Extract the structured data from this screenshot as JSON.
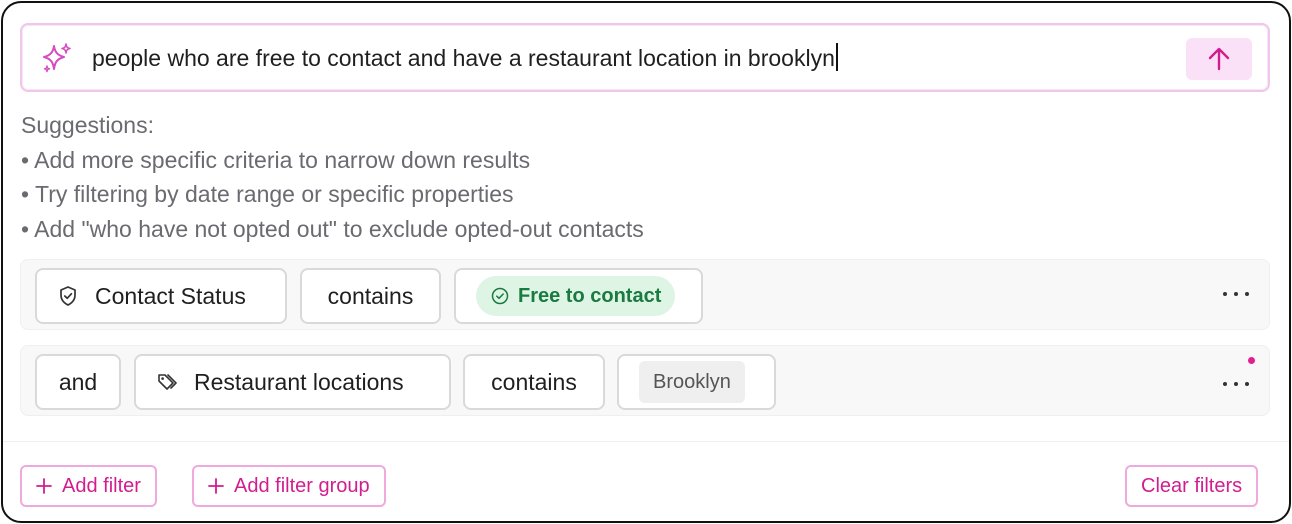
{
  "prompt": {
    "query": "people who are free to contact and have a restaurant location in brooklyn",
    "sparkle_icon": "sparkles-icon",
    "send_icon": "arrow-up-icon"
  },
  "suggestions": {
    "title": "Suggestions:",
    "items": [
      "• Add more specific criteria to narrow down results",
      "• Try filtering by date range or specific properties",
      "• Add \"who have not opted out\" to exclude opted-out contacts"
    ]
  },
  "filters": [
    {
      "field": "Contact Status",
      "field_icon": "shield-check-icon",
      "operator": "contains",
      "value": "Free to contact",
      "value_icon": "check-circle-icon"
    },
    {
      "conjunction": "and",
      "field": "Restaurant locations",
      "field_icon": "tags-icon",
      "operator": "contains",
      "value": "Brooklyn"
    }
  ],
  "actions": {
    "add_filter": "Add filter",
    "add_filter_group": "Add filter group",
    "clear_filters": "Clear filters"
  },
  "colors": {
    "accent": "#d21d8f",
    "accent_border": "#f0a9dc",
    "success_bg": "#def5e6",
    "success_text": "#1a7a3f"
  }
}
